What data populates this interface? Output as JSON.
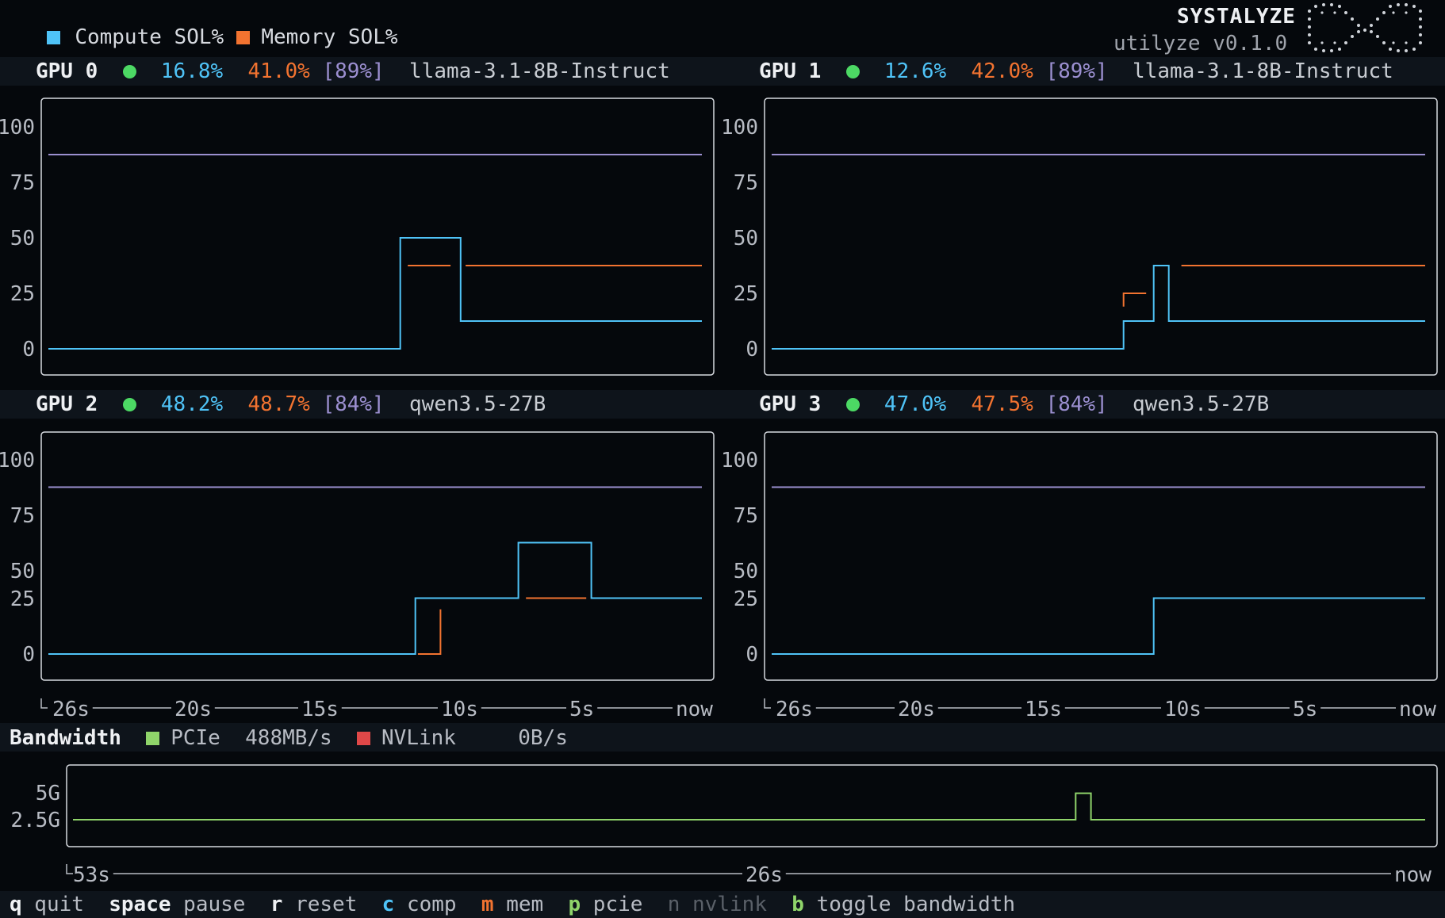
{
  "legend": {
    "compute": {
      "label": "Compute SOL%",
      "color": "#4fc3f7"
    },
    "memory": {
      "label": "Memory SOL%",
      "color": "#f27330"
    }
  },
  "brand": {
    "name": "SYSTALYZE",
    "subtitle": "utilyze v0.1.0",
    "logo": "dotted-infinity-logo"
  },
  "colors": {
    "limit": "#9b8fd0",
    "status_ok": "#4cd964",
    "pcie": "#8fd46a",
    "nvlink": "#e04848",
    "frame": "#d7dae0"
  },
  "gpus": [
    {
      "name": "GPU 0",
      "compute": "16.8%",
      "memory": "41.0%",
      "limit": "[89%]",
      "model": "llama-3.1-8B-Instruct"
    },
    {
      "name": "GPU 1",
      "compute": "12.6%",
      "memory": "42.0%",
      "limit": "[89%]",
      "model": "llama-3.1-8B-Instruct"
    },
    {
      "name": "GPU 2",
      "compute": "48.2%",
      "memory": "48.7%",
      "limit": "[84%]",
      "model": "qwen3.5-27B"
    },
    {
      "name": "GPU 3",
      "compute": "47.0%",
      "memory": "47.5%",
      "limit": "[84%]",
      "model": "qwen3.5-27B"
    }
  ],
  "gpu_xaxis": [
    "26s",
    "20s",
    "15s",
    "10s",
    "5s",
    "now"
  ],
  "bandwidth": {
    "title": "Bandwidth",
    "pcie": {
      "label": "PCIe",
      "value": "488MB/s"
    },
    "nvlink": {
      "label": "NVLink",
      "value": "0B/s"
    },
    "yticks": [
      "5G",
      "2.5G"
    ],
    "xticks": [
      "53s",
      "26s",
      "now"
    ]
  },
  "shortcuts": [
    {
      "key": "q",
      "label": "quit",
      "color": "#eef0f3",
      "bold": true
    },
    {
      "key": "space",
      "label": "pause",
      "color": "#eef0f3",
      "bold": true
    },
    {
      "key": "r",
      "label": "reset",
      "color": "#eef0f3",
      "bold": true
    },
    {
      "key": "c",
      "label": "comp",
      "color": "#4fc3f7",
      "bold": true
    },
    {
      "key": "m",
      "label": "mem",
      "color": "#f27330",
      "bold": true
    },
    {
      "key": "p",
      "label": "pcie",
      "color": "#8fd46a",
      "bold": true
    },
    {
      "key": "n",
      "label": "nvlink",
      "color": "#5a6068",
      "bold": false
    },
    {
      "key": "b",
      "label": "toggle bandwidth",
      "color": "#8fd46a",
      "bold": true
    }
  ],
  "chart_data": [
    {
      "type": "line",
      "title": "GPU 0",
      "yticks": [
        100,
        75,
        50,
        25,
        0
      ],
      "ylim": [
        0,
        100
      ],
      "x_ticks": [
        "26s",
        "20s",
        "15s",
        "10s",
        "5s",
        "now"
      ],
      "series": [
        {
          "name": "Compute SOL%",
          "points": [
            [
              -26,
              0
            ],
            [
              -12,
              0
            ],
            [
              -12,
              50
            ],
            [
              -9.6,
              50
            ],
            [
              -9.6,
              12.5
            ],
            [
              0,
              12.5
            ]
          ]
        },
        {
          "name": "Memory SOL%",
          "segments": [
            [
              [
                -11.7,
                37.5
              ],
              [
                -10,
                37.5
              ]
            ],
            [
              [
                -9.4,
                37.5
              ],
              [
                0,
                37.5
              ]
            ]
          ]
        },
        {
          "name": "[89%]",
          "points": [
            [
              -26,
              87.5
            ],
            [
              0,
              87.5
            ]
          ]
        }
      ]
    },
    {
      "type": "line",
      "title": "GPU 1",
      "yticks": [
        100,
        75,
        50,
        25,
        0
      ],
      "ylim": [
        0,
        100
      ],
      "x_ticks": [
        "26s",
        "20s",
        "15s",
        "10s",
        "5s",
        "now"
      ],
      "series": [
        {
          "name": "Compute SOL%",
          "points": [
            [
              -26,
              0
            ],
            [
              -12,
              0
            ],
            [
              -12,
              12.5
            ],
            [
              -10.8,
              12.5
            ],
            [
              -10.8,
              37.5
            ],
            [
              -10.2,
              37.5
            ],
            [
              -10.2,
              12.5
            ],
            [
              0,
              12.5
            ]
          ]
        },
        {
          "name": "Memory SOL%",
          "segments": [
            [
              [
                -12,
                19
              ],
              [
                -12,
                25
              ],
              [
                -11.1,
                25
              ]
            ],
            [
              [
                -9.7,
                37.5
              ],
              [
                0,
                37.5
              ]
            ]
          ]
        },
        {
          "name": "[89%]",
          "points": [
            [
              -26,
              87.5
            ],
            [
              0,
              87.5
            ]
          ]
        }
      ]
    },
    {
      "type": "line",
      "title": "GPU 2",
      "yticks": [
        100,
        75,
        50,
        25,
        0
      ],
      "ylim": [
        0,
        100
      ],
      "x_ticks": [
        "26s",
        "20s",
        "15s",
        "10s",
        "5s",
        "now"
      ],
      "series": [
        {
          "name": "Compute SOL%",
          "points": [
            [
              -26,
              0
            ],
            [
              -11.4,
              0
            ],
            [
              -11.4,
              37.5
            ],
            [
              -10.6,
              37.5
            ],
            [
              -10.6,
              37.5
            ],
            [
              -7.3,
              37.5
            ],
            [
              -7.3,
              50
            ],
            [
              -4.4,
              50
            ],
            [
              -4.4,
              37.5
            ],
            [
              0,
              37.5
            ]
          ]
        },
        {
          "name": "Memory SOL%",
          "segments": [
            [
              [
                -11.3,
                0
              ],
              [
                -10.4,
                0
              ],
              [
                -10.4,
                30
              ]
            ],
            [
              [
                -7,
                37.5
              ],
              [
                -4.6,
                37.5
              ]
            ]
          ]
        },
        {
          "name": "[84%]",
          "points": [
            [
              -26,
              75
            ],
            [
              0,
              75
            ]
          ]
        }
      ]
    },
    {
      "type": "line",
      "title": "GPU 3",
      "yticks": [
        100,
        75,
        50,
        25,
        0
      ],
      "ylim": [
        0,
        100
      ],
      "x_ticks": [
        "26s",
        "20s",
        "15s",
        "10s",
        "5s",
        "now"
      ],
      "series": [
        {
          "name": "Compute SOL%",
          "points": [
            [
              -26,
              0
            ],
            [
              -10.8,
              0
            ],
            [
              -10.8,
              37.5
            ],
            [
              0,
              37.5
            ]
          ]
        },
        {
          "name": "[84%]",
          "points": [
            [
              -26,
              75
            ],
            [
              0,
              75
            ]
          ]
        }
      ]
    },
    {
      "type": "line",
      "title": "Bandwidth",
      "yticks": [
        "5G",
        "2.5G"
      ],
      "x_ticks": [
        "53s",
        "26s",
        "now"
      ],
      "series": [
        {
          "name": "PCIe",
          "points": [
            [
              -53,
              0.488
            ],
            [
              -13.7,
              0.488
            ],
            [
              -13.7,
              1.5
            ],
            [
              -13.1,
              1.5
            ],
            [
              -13.1,
              0.488
            ],
            [
              0,
              0.488
            ]
          ]
        }
      ]
    }
  ]
}
